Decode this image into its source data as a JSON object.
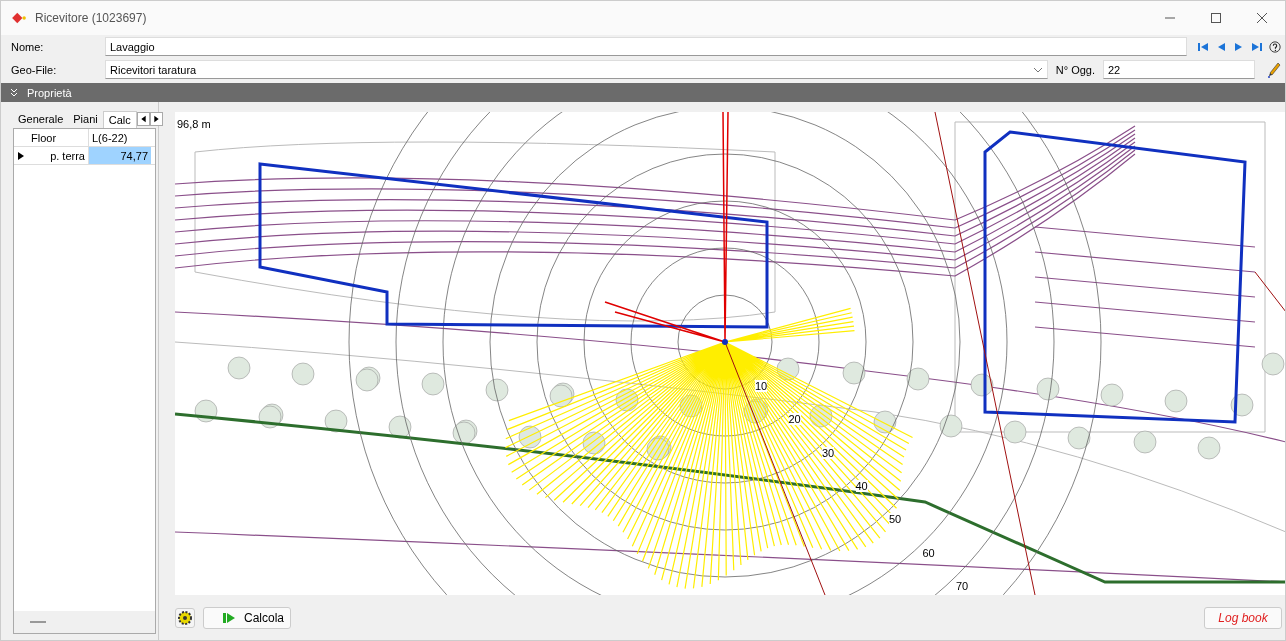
{
  "window": {
    "title": "Ricevitore (1023697)"
  },
  "form": {
    "name_label": "Nome:",
    "name_value": "Lavaggio",
    "geofile_label": "Geo-File:",
    "geofile_value": "Ricevitori taratura",
    "object_label": "N° Ogg.",
    "object_value": "22"
  },
  "section": {
    "title": "Proprietà",
    "expanded": true
  },
  "tabs": [
    {
      "label": "Generale",
      "selected": false
    },
    {
      "label": "Piani",
      "selected": false
    },
    {
      "label": "Calc",
      "selected": true
    }
  ],
  "table": {
    "columns": [
      "Floor",
      "L(6-22)"
    ],
    "rows": [
      {
        "selected": true,
        "cells": [
          "p. terra",
          "74,77"
        ]
      }
    ]
  },
  "map": {
    "scale": "96,8 m",
    "ring_labels": [
      "10",
      "20",
      "30",
      "40",
      "50",
      "60",
      "70"
    ]
  },
  "buttons": {
    "calculate": "Calcola",
    "log": "Log book"
  }
}
